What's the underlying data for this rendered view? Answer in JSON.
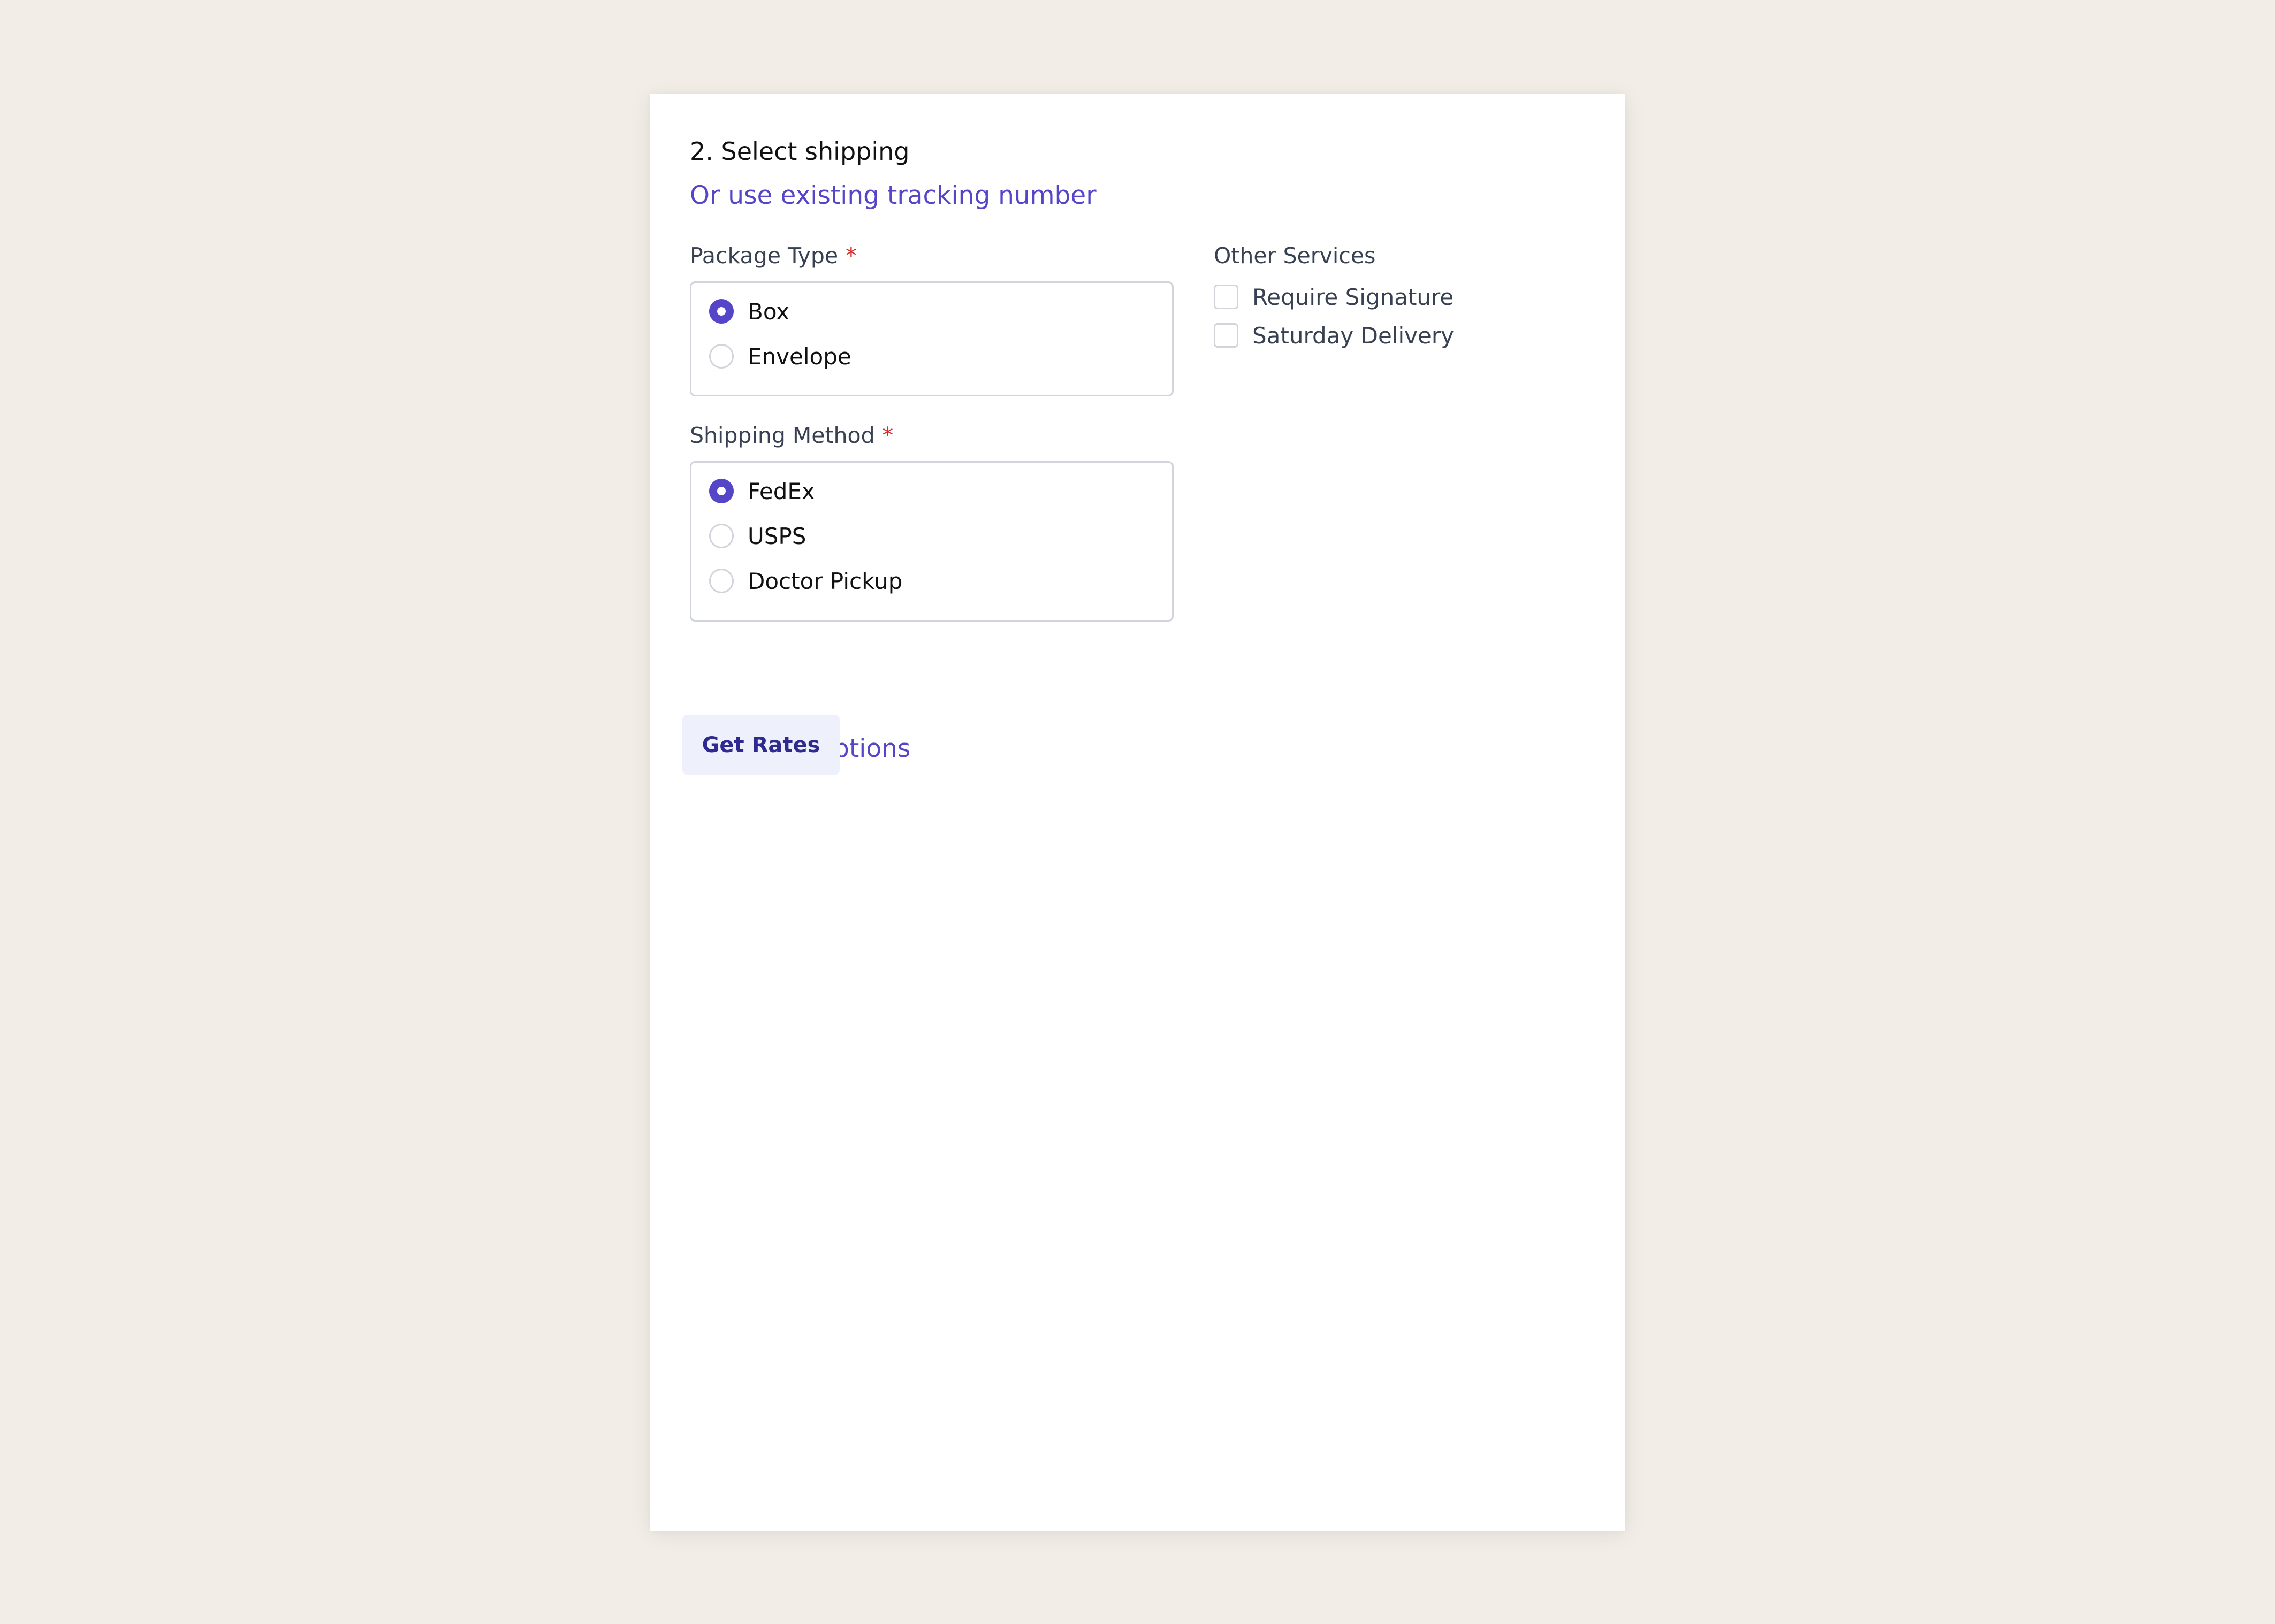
{
  "section": {
    "title": "2. Select shipping",
    "tracking_link": "Or use existing tracking number"
  },
  "package_type": {
    "label": "Package Type",
    "required_mark": "*",
    "options": [
      {
        "label": "Box",
        "selected": true
      },
      {
        "label": "Envelope",
        "selected": false
      }
    ]
  },
  "shipping_method": {
    "label": "Shipping Method",
    "required_mark": "*",
    "options": [
      {
        "label": "FedEx",
        "selected": true
      },
      {
        "label": "USPS",
        "selected": false
      },
      {
        "label": "Doctor Pickup",
        "selected": false
      }
    ]
  },
  "other_services": {
    "label": "Other Services",
    "options": [
      {
        "label": "Require Signature",
        "checked": false
      },
      {
        "label": "Saturday Delivery",
        "checked": false
      }
    ]
  },
  "see_more_link": "See more options",
  "get_rates_button": "Get Rates",
  "colors": {
    "accent": "#5546c9",
    "required": "#dc2626",
    "page_background": "#f2eee7",
    "button_background": "#eef0fc"
  }
}
